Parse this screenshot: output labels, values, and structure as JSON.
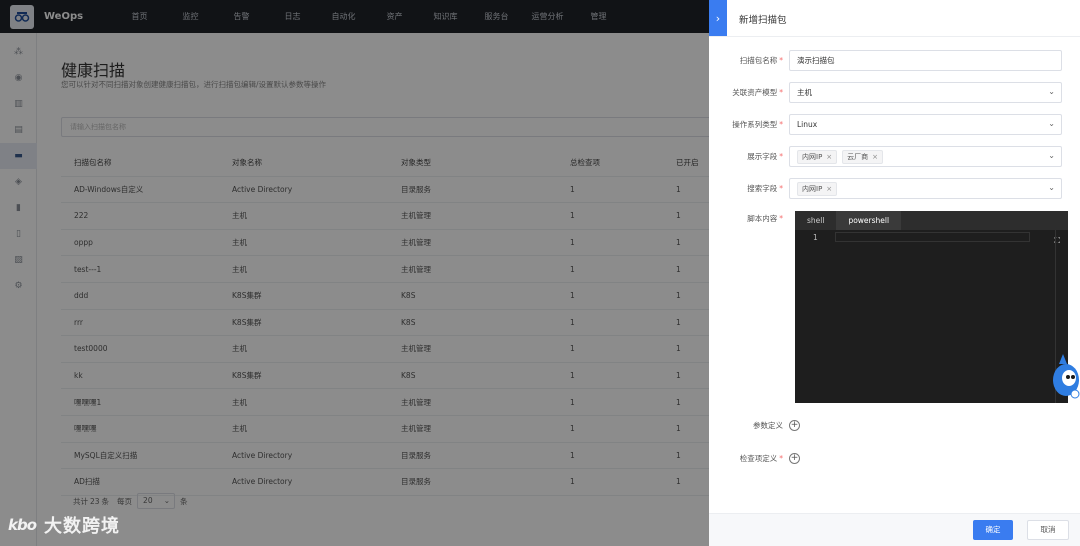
{
  "app": {
    "name": "WeOps"
  },
  "nav": {
    "items": [
      "首页",
      "监控",
      "告警",
      "日志",
      "自动化",
      "资产",
      "知识库",
      "服务台",
      "运营分析",
      "管理"
    ]
  },
  "sidebar": {
    "icons": [
      "topology-icon",
      "monitor-icon",
      "chart-icon",
      "report-icon",
      "briefcase-icon",
      "layers-icon",
      "document-icon",
      "clipboard-icon",
      "analytics-icon",
      "settings-icon"
    ],
    "active_index": 4
  },
  "page": {
    "title": "健康扫描",
    "description": "您可以针对不同扫描对象创建健康扫描包，进行扫描包编辑/设置默认参数等操作",
    "search_placeholder": "请输入扫描包名称"
  },
  "table": {
    "columns": [
      "扫描包名称",
      "对象名称",
      "对象类型",
      "总检查项",
      "已开启"
    ],
    "rows": [
      [
        "AD-Windows自定义",
        "Active Directory",
        "目录服务",
        "1",
        "1"
      ],
      [
        "222",
        "主机",
        "主机管理",
        "1",
        "1"
      ],
      [
        "oppp",
        "主机",
        "主机管理",
        "1",
        "1"
      ],
      [
        "test---1",
        "主机",
        "主机管理",
        "1",
        "1"
      ],
      [
        "ddd",
        "K8S集群",
        "K8S",
        "1",
        "1"
      ],
      [
        "rrr",
        "K8S集群",
        "K8S",
        "1",
        "1"
      ],
      [
        "test0000",
        "主机",
        "主机管理",
        "1",
        "1"
      ],
      [
        "kk",
        "K8S集群",
        "K8S",
        "1",
        "1"
      ],
      [
        "嘿嘿嘿1",
        "主机",
        "主机管理",
        "1",
        "1"
      ],
      [
        "嘿嘿嘿",
        "主机",
        "主机管理",
        "1",
        "1"
      ],
      [
        "MySQL自定义扫描",
        "Active Directory",
        "目录服务",
        "1",
        "1"
      ],
      [
        "AD扫描",
        "Active Directory",
        "目录服务",
        "1",
        "1"
      ]
    ]
  },
  "pager": {
    "total_prefix": "共计",
    "total": "23",
    "total_suffix": "条",
    "per_page_label": "每页",
    "per_page": "20",
    "per_page_suffix": "条"
  },
  "watermark": {
    "logo": "kbo",
    "text": "大数跨境"
  },
  "drawer": {
    "title": "新增扫描包",
    "fields": {
      "name": {
        "label": "扫描包名称",
        "value": "演示扫描包"
      },
      "model": {
        "label": "关联资产模型",
        "value": "主机"
      },
      "os": {
        "label": "操作系列类型",
        "value": "Linux"
      },
      "display": {
        "label": "展示字段",
        "tags": [
          "内网IP",
          "云厂商"
        ]
      },
      "search": {
        "label": "搜索字段",
        "tags": [
          "内网IP"
        ]
      },
      "script": {
        "label": "脚本内容",
        "tabs": [
          "shell",
          "powershell"
        ],
        "line": "1"
      },
      "params": {
        "label": "参数定义"
      },
      "checks": {
        "label": "检查项定义"
      }
    },
    "ok_label": "确定",
    "cancel_label": "取消",
    "required_mark": "*"
  },
  "colors": {
    "accent": "#3a7cf0",
    "nav_bg": "#1f2329",
    "editor_bg": "#1e1e1e",
    "required": "#f56c6c"
  }
}
